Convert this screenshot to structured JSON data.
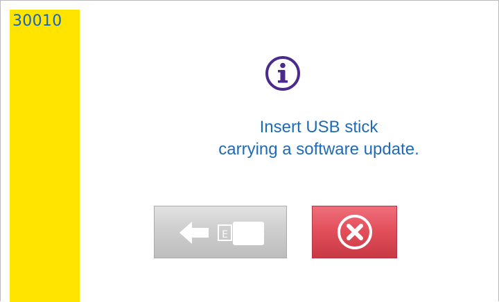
{
  "screen": {
    "code": "30010"
  },
  "dialog": {
    "icon": "info-icon",
    "message_line1": "Insert USB stick",
    "message_line2": "carrying a software update.",
    "back_button_icon": "back-arrow-exit-icon",
    "cancel_button_icon": "cancel-x-icon"
  },
  "colors": {
    "sidebar": "#ffe400",
    "code_text": "#1565c0",
    "message_text": "#1e6bb8",
    "info_icon": "#4a2a8c",
    "cancel_button": "#e3505c",
    "back_button": "#c8c8c8"
  }
}
